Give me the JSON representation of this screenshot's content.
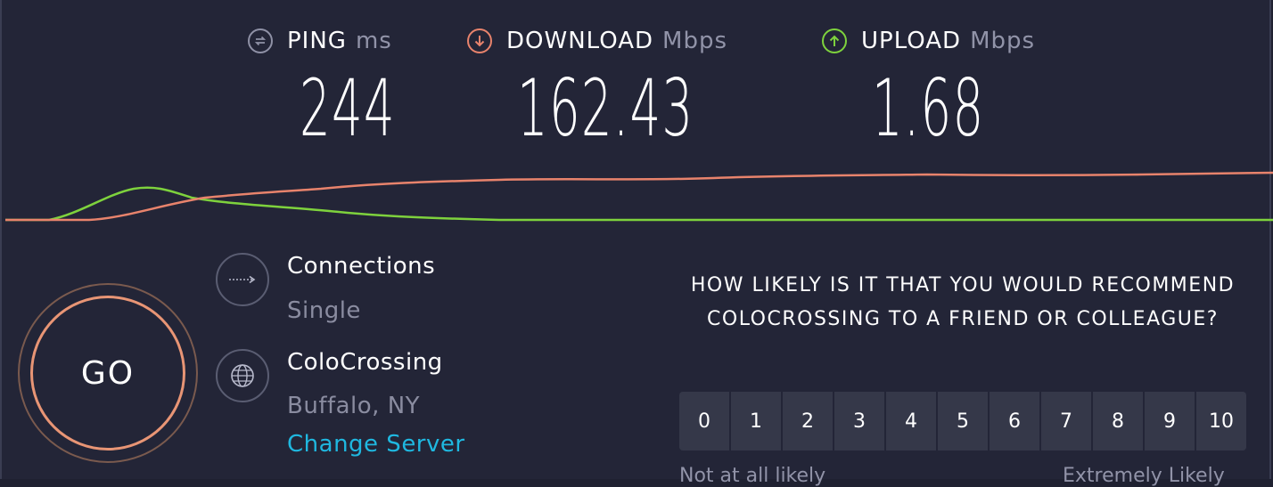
{
  "metrics": {
    "ping": {
      "label": "PING",
      "unit": "ms",
      "value": "244",
      "color": "#8f91a6"
    },
    "download": {
      "label": "DOWNLOAD",
      "unit": "Mbps",
      "value": "162.43",
      "color": "#e8836c"
    },
    "upload": {
      "label": "UPLOAD",
      "unit": "Mbps",
      "value": "1.68",
      "color": "#7ed23d"
    }
  },
  "graph": {
    "download_color": "#e8836c",
    "upload_color": "#7ed23d"
  },
  "go_button": {
    "label": "GO"
  },
  "connections": {
    "title": "Connections",
    "value": "Single",
    "icon": "arrow-right-icon"
  },
  "server": {
    "name": "ColoCrossing",
    "location": "Buffalo, NY",
    "change_label": "Change Server",
    "icon": "globe-icon"
  },
  "survey": {
    "question": "HOW LIKELY IS IT THAT YOU WOULD RECOMMEND COLOCROSSING TO A FRIEND OR COLLEAGUE?",
    "options": [
      "0",
      "1",
      "2",
      "3",
      "4",
      "5",
      "6",
      "7",
      "8",
      "9",
      "10"
    ],
    "low_label": "Not at all likely",
    "high_label": "Extremely Likely"
  }
}
